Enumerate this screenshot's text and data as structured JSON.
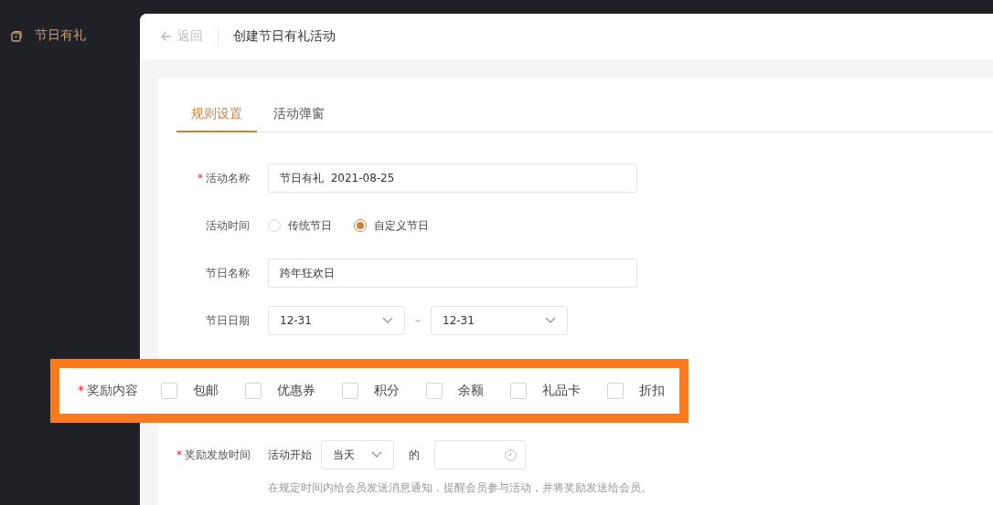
{
  "sidebar": {
    "items": [
      {
        "label": "节日有礼",
        "selected": true
      }
    ]
  },
  "header": {
    "back": "返回",
    "title": "创建节日有礼活动"
  },
  "tabs": [
    {
      "label": "规则设置",
      "selected": true
    },
    {
      "label": "活动弹窗",
      "selected": false
    }
  ],
  "form": {
    "fields": [
      {
        "kind": "text",
        "label": "活动名称",
        "required_mark": "*",
        "value": "节日有礼  2021-08-25"
      },
      {
        "kind": "radio",
        "label": "活动时间",
        "options": [
          {
            "label": "传统节日",
            "selected": false
          },
          {
            "label": "自定义节日",
            "selected": true
          }
        ]
      },
      {
        "kind": "text",
        "label": "节日名称",
        "value": "跨年狂欢日"
      },
      {
        "kind": "range",
        "label": "节日日期",
        "from": "12-31",
        "separator": "–",
        "to": "12-31"
      },
      {
        "kind": "checkboxes",
        "label": "奖励内容",
        "required_mark": "*",
        "highlighted": true,
        "options": [
          {
            "label": "包邮",
            "checked": false
          },
          {
            "label": "优惠券",
            "checked": false
          },
          {
            "label": "积分",
            "checked": false
          },
          {
            "label": "余额",
            "checked": false
          },
          {
            "label": "礼品卡",
            "checked": false
          },
          {
            "label": "折扣",
            "checked": false
          }
        ]
      },
      {
        "kind": "schedule",
        "label": "奖励发放时间",
        "required_mark": "*",
        "prefix": "活动开始",
        "day": "当天",
        "connector": "的",
        "hint": "在规定时间内给会员发送消息通知，提醒会员参与活动，并将奖励发送给会员。"
      }
    ]
  }
}
